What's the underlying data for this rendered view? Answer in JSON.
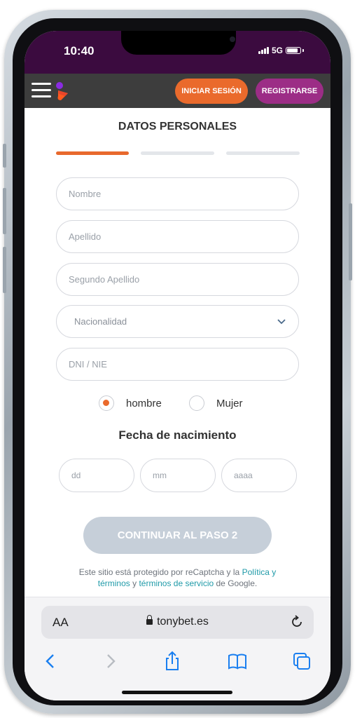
{
  "status_bar": {
    "time": "10:40",
    "network": "5G"
  },
  "header": {
    "login_label": "INICIAR SESIÓN",
    "register_label": "REGISTRARSE"
  },
  "form": {
    "title": "DATOS PERSONALES",
    "steps_total": 3,
    "active_step": 1,
    "fields": {
      "nombre": "Nombre",
      "apellido": "Apellido",
      "segundo_apellido": "Segundo Apellido",
      "nacionalidad": "Nacionalidad",
      "dni": "DNI / NIE"
    },
    "gender": {
      "male_label": "hombre",
      "female_label": "Mujer",
      "selected": "hombre"
    },
    "dob": {
      "title": "Fecha de nacimiento",
      "day": "dd",
      "month": "mm",
      "year": "aaaa"
    },
    "continue_label": "CONTINUAR AL PASO 2",
    "recaptcha": {
      "text_1": "Este sitio está protegido por reCaptcha y la",
      "policy_link": "Política y términos",
      "conjunction": " y ",
      "terms_link": "términos de servicio",
      "text_2": " de Google."
    }
  },
  "browser": {
    "aa_label": "AA",
    "url": "tonybet.es"
  },
  "colors": {
    "accent": "#ea6a2c",
    "register": "#9c2d86",
    "header_bg": "#3d3d3d",
    "status_bg": "#3b0b3f",
    "link": "#1f9aa8"
  }
}
